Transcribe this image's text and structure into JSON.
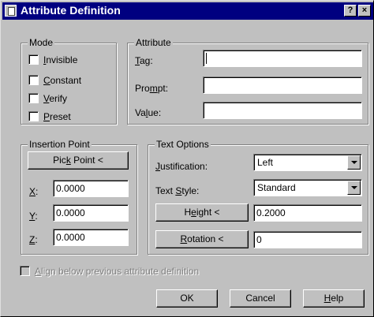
{
  "window": {
    "title": "Attribute Definition",
    "help_glyph": "?",
    "close_glyph": "×"
  },
  "mode": {
    "legend": "Mode",
    "invisible": {
      "pre": "",
      "key": "I",
      "post": "nvisible",
      "checked": false
    },
    "constant": {
      "pre": "",
      "key": "C",
      "post": "onstant",
      "checked": false
    },
    "verify": {
      "pre": "",
      "key": "V",
      "post": "erify",
      "checked": false
    },
    "preset": {
      "pre": "",
      "key": "P",
      "post": "reset",
      "checked": false
    }
  },
  "attribute": {
    "legend": "Attribute",
    "tag": {
      "pre": "",
      "key": "T",
      "post": "ag:",
      "value": ""
    },
    "prompt": {
      "pre": "Pro",
      "key": "m",
      "post": "pt:",
      "value": ""
    },
    "value": {
      "pre": "Va",
      "key": "l",
      "post": "ue:",
      "value": ""
    }
  },
  "insertion": {
    "legend": "Insertion Point",
    "pick": {
      "pre": "Pic",
      "key": "k",
      "post": " Point <"
    },
    "x": {
      "key": "X",
      "post": ":",
      "value": "0.0000"
    },
    "y": {
      "key": "Y",
      "post": ":",
      "value": "0.0000"
    },
    "z": {
      "key": "Z",
      "post": ":",
      "value": "0.0000"
    }
  },
  "text_options": {
    "legend": "Text Options",
    "justification": {
      "pre": "",
      "key": "J",
      "post": "ustification:",
      "value": "Left"
    },
    "text_style": {
      "pre": "Text ",
      "key": "S",
      "post": "tyle:",
      "value": "Standard"
    },
    "height": {
      "pre": "H",
      "key": "e",
      "post": "ight <",
      "value": "0.2000"
    },
    "rotation": {
      "pre": "",
      "key": "R",
      "post": "otation <",
      "value": "0"
    }
  },
  "align": {
    "pre": "",
    "key": "A",
    "post": "lign below previous attribute definition",
    "checked": false,
    "enabled": false
  },
  "buttons": {
    "ok": "OK",
    "cancel": "Cancel",
    "help": {
      "pre": "",
      "key": "H",
      "post": "elp"
    }
  }
}
